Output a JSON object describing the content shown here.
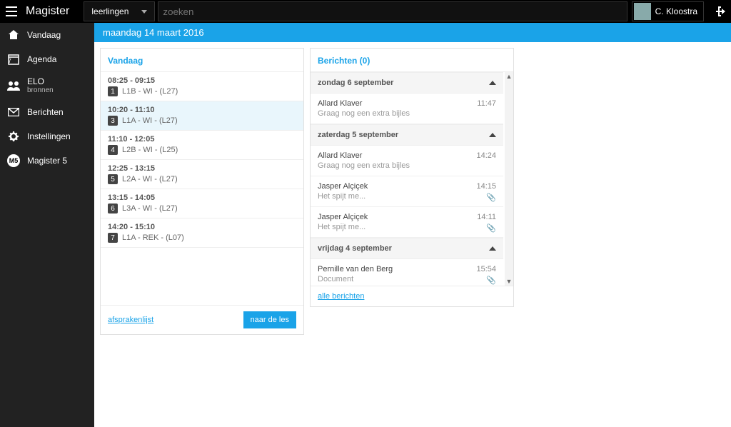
{
  "brand": "Magister",
  "selector": {
    "label": "leerlingen"
  },
  "search": {
    "placeholder": "zoeken",
    "value": ""
  },
  "user": {
    "name": "C. Kloostra"
  },
  "datebar": "maandag 14 maart 2016",
  "sidebar": {
    "items": [
      {
        "label": "Vandaag"
      },
      {
        "label": "Agenda"
      },
      {
        "label": "ELO",
        "sub": "bronnen"
      },
      {
        "label": "Berichten"
      },
      {
        "label": "Instellingen"
      },
      {
        "label": "Magister 5"
      }
    ]
  },
  "vandaag": {
    "title": "Vandaag",
    "items": [
      {
        "time": "08:25 - 09:15",
        "period": "1",
        "text": "L1B - WI - (L27)",
        "active": false
      },
      {
        "time": "10:20 - 11:10",
        "period": "3",
        "text": "L1A - WI - (L27)",
        "active": true
      },
      {
        "time": "11:10 - 12:05",
        "period": "4",
        "text": "L2B - WI - (L25)",
        "active": false
      },
      {
        "time": "12:25 - 13:15",
        "period": "5",
        "text": "L2A - WI - (L27)",
        "active": false
      },
      {
        "time": "13:15 - 14:05",
        "period": "6",
        "text": "L3A - WI - (L27)",
        "active": false
      },
      {
        "time": "14:20 - 15:10",
        "period": "7",
        "text": "L1A - REK - (L07)",
        "active": false
      }
    ],
    "footer_link": "afsprakenlijst",
    "footer_button": "naar de les"
  },
  "berichten": {
    "title": "Berichten (0)",
    "groups": [
      {
        "day": "zondag 6 september",
        "msgs": [
          {
            "sender": "Allard Klaver",
            "snippet": "Graag nog een extra bijles",
            "time": "11:47",
            "attach": false
          }
        ]
      },
      {
        "day": "zaterdag 5 september",
        "msgs": [
          {
            "sender": "Allard Klaver",
            "snippet": "Graag nog een extra bijles",
            "time": "14:24",
            "attach": false
          },
          {
            "sender": "Jasper Alçiçek",
            "snippet": "Het spijt me...",
            "time": "14:15",
            "attach": true
          },
          {
            "sender": "Jasper Alçiçek",
            "snippet": "Het spijt me...",
            "time": "14:11",
            "attach": true
          }
        ]
      },
      {
        "day": "vrijdag 4 september",
        "msgs": [
          {
            "sender": "Pernille van den Berg",
            "snippet": "Document",
            "time": "15:54",
            "attach": true
          }
        ]
      }
    ],
    "footer_link": "alle berichten"
  }
}
